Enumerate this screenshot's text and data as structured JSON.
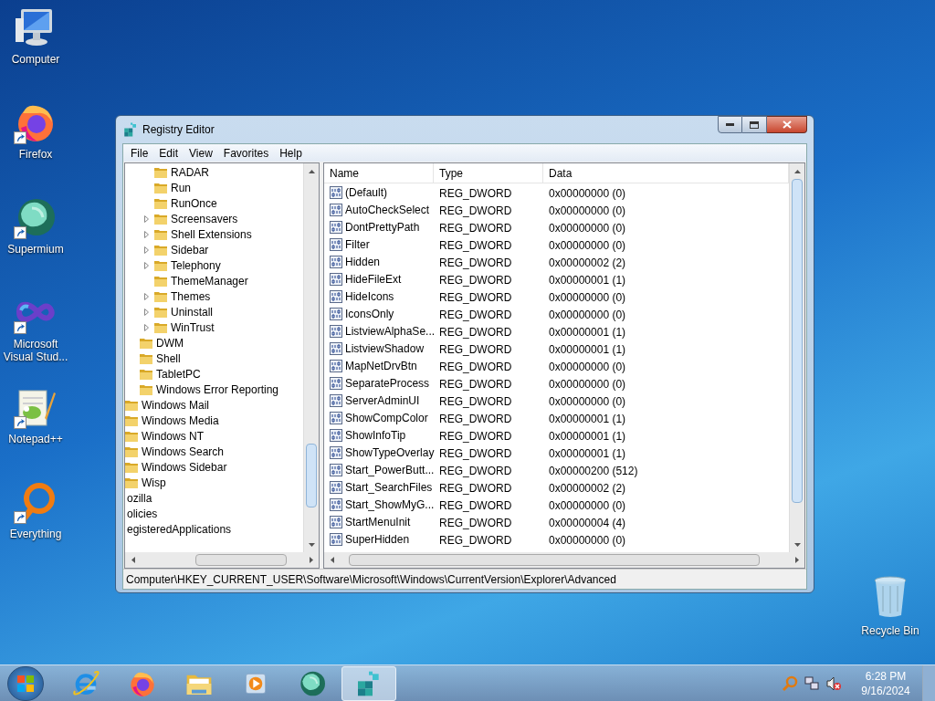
{
  "desktop_icons": [
    {
      "kind": "computer",
      "label": "Computer",
      "shortcut": false
    },
    {
      "kind": "firefox",
      "label": "Firefox",
      "shortcut": true
    },
    {
      "kind": "supermium",
      "label": "Supermium",
      "shortcut": true
    },
    {
      "kind": "infinity",
      "label": "Microsoft Visual Stud...",
      "shortcut": true
    },
    {
      "kind": "notepad",
      "label": "Notepad++",
      "shortcut": true
    },
    {
      "kind": "ring",
      "label": "Everything",
      "shortcut": true
    }
  ],
  "recycle_bin": {
    "label": "Recycle Bin"
  },
  "window": {
    "title": "Registry Editor",
    "menu": [
      "File",
      "Edit",
      "View",
      "Favorites",
      "Help"
    ],
    "tree": [
      {
        "children": [
          {
            "children": [
              {
                "children": [
                  {
                    "label": "RADAR",
                    "expandable": false
                  },
                  {
                    "label": "Run",
                    "expandable": false
                  },
                  {
                    "label": "RunOnce",
                    "expandable": false
                  },
                  {
                    "label": "Screensavers",
                    "expandable": true
                  },
                  {
                    "label": "Shell Extensions",
                    "expandable": true
                  },
                  {
                    "label": "Sidebar",
                    "expandable": true
                  },
                  {
                    "label": "Telephony",
                    "expandable": true
                  },
                  {
                    "label": "ThemeManager",
                    "expandable": false
                  },
                  {
                    "label": "Themes",
                    "expandable": true
                  },
                  {
                    "label": "Uninstall",
                    "expandable": true
                  },
                  {
                    "label": "WinTrust",
                    "expandable": true
                  }
                ]
              },
              {
                "label": "DWM"
              },
              {
                "label": "Shell"
              },
              {
                "label": "TabletPC"
              },
              {
                "label": "Windows Error Reporting"
              }
            ]
          },
          {
            "label": "Windows Mail"
          },
          {
            "label": "Windows Media"
          },
          {
            "label": "Windows NT"
          },
          {
            "label": "Windows Search"
          },
          {
            "label": "Windows Sidebar"
          },
          {
            "label": "Wisp"
          }
        ]
      },
      {
        "label": "ozilla"
      },
      {
        "label": "olicies"
      },
      {
        "label": "egisteredApplications"
      }
    ],
    "columns": [
      "Name",
      "Type",
      "Data"
    ],
    "rows": [
      {
        "name": "(Default)",
        "type": "REG_DWORD",
        "data": "0x00000000 (0)"
      },
      {
        "name": "AutoCheckSelect",
        "type": "REG_DWORD",
        "data": "0x00000000 (0)"
      },
      {
        "name": "DontPrettyPath",
        "type": "REG_DWORD",
        "data": "0x00000000 (0)"
      },
      {
        "name": "Filter",
        "type": "REG_DWORD",
        "data": "0x00000000 (0)"
      },
      {
        "name": "Hidden",
        "type": "REG_DWORD",
        "data": "0x00000002 (2)"
      },
      {
        "name": "HideFileExt",
        "type": "REG_DWORD",
        "data": "0x00000001 (1)"
      },
      {
        "name": "HideIcons",
        "type": "REG_DWORD",
        "data": "0x00000000 (0)"
      },
      {
        "name": "IconsOnly",
        "type": "REG_DWORD",
        "data": "0x00000000 (0)"
      },
      {
        "name": "ListviewAlphaSe...",
        "type": "REG_DWORD",
        "data": "0x00000001 (1)"
      },
      {
        "name": "ListviewShadow",
        "type": "REG_DWORD",
        "data": "0x00000001 (1)"
      },
      {
        "name": "MapNetDrvBtn",
        "type": "REG_DWORD",
        "data": "0x00000000 (0)"
      },
      {
        "name": "SeparateProcess",
        "type": "REG_DWORD",
        "data": "0x00000000 (0)"
      },
      {
        "name": "ServerAdminUI",
        "type": "REG_DWORD",
        "data": "0x00000000 (0)"
      },
      {
        "name": "ShowCompColor",
        "type": "REG_DWORD",
        "data": "0x00000001 (1)"
      },
      {
        "name": "ShowInfoTip",
        "type": "REG_DWORD",
        "data": "0x00000001 (1)"
      },
      {
        "name": "ShowTypeOverlay",
        "type": "REG_DWORD",
        "data": "0x00000001 (1)"
      },
      {
        "name": "Start_PowerButt...",
        "type": "REG_DWORD",
        "data": "0x00000200 (512)"
      },
      {
        "name": "Start_SearchFiles",
        "type": "REG_DWORD",
        "data": "0x00000002 (2)"
      },
      {
        "name": "Start_ShowMyG...",
        "type": "REG_DWORD",
        "data": "0x00000000 (0)"
      },
      {
        "name": "StartMenuInit",
        "type": "REG_DWORD",
        "data": "0x00000004 (4)"
      },
      {
        "name": "SuperHidden",
        "type": "REG_DWORD",
        "data": "0x00000000 (0)"
      }
    ],
    "status_bar": "Computer\\HKEY_CURRENT_USER\\Software\\Microsoft\\Windows\\CurrentVersion\\Explorer\\Advanced"
  },
  "taskbar": {
    "apps": [
      {
        "kind": "ie",
        "selected": false
      },
      {
        "kind": "firefox",
        "selected": false
      },
      {
        "kind": "folder",
        "selected": false
      },
      {
        "kind": "media",
        "selected": false
      },
      {
        "kind": "supermium",
        "selected": false
      },
      {
        "kind": "registry",
        "selected": true
      }
    ],
    "time": "6:28 PM",
    "date": "9/16/2024"
  }
}
